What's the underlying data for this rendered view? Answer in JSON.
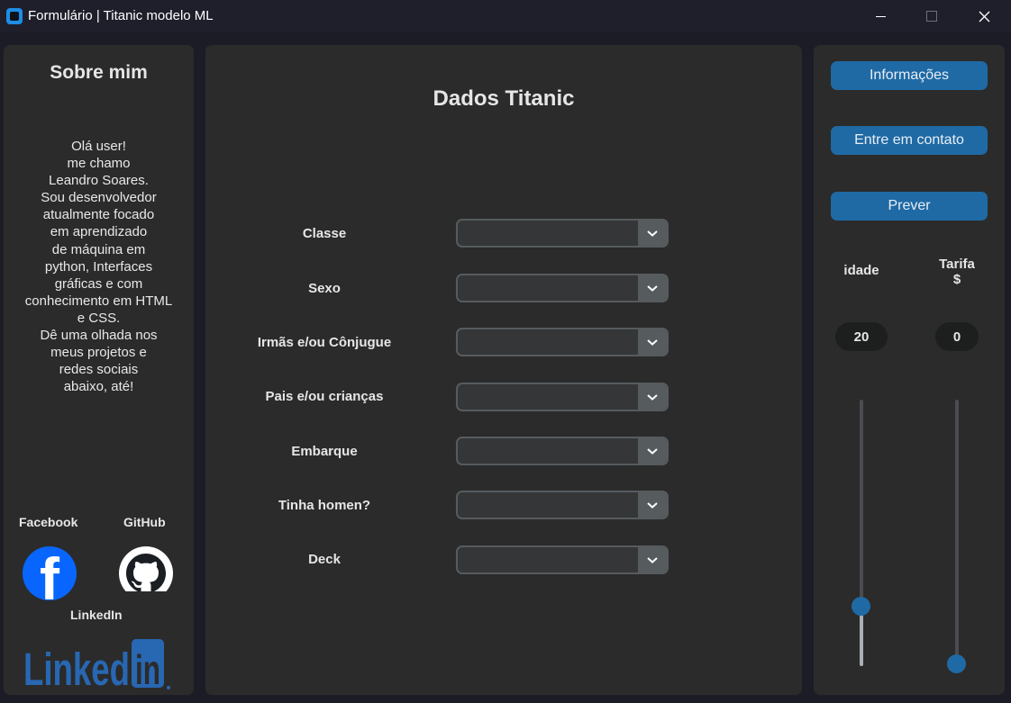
{
  "window": {
    "title": "Formulário | Titanic modelo ML"
  },
  "about": {
    "title": "Sobre mim",
    "text": "Olá user!\nme chamo\nLeandro Soares.\nSou desenvolvedor\natualmente focado\nem aprendizado\nde máquina em\npython, Interfaces\ngráficas e com\nconhecimento em HTML\ne CSS.\nDê uma olhada nos\nmeus projetos e\nredes sociais\nabaixo, até!"
  },
  "social": {
    "facebook_label": "Facebook",
    "github_label": "GitHub",
    "linkedin_label": "LinkedIn",
    "linkedin_logo_text": "Linked",
    "linkedin_logo_in": "in",
    "facebook_glyph": "f"
  },
  "form": {
    "title": "Dados Titanic",
    "fields": [
      {
        "label": "Classe",
        "value": ""
      },
      {
        "label": "Sexo",
        "value": ""
      },
      {
        "label": "Irmãs e/ou Cônjugue",
        "value": ""
      },
      {
        "label": "Pais e/ou crianças",
        "value": ""
      },
      {
        "label": "Embarque",
        "value": ""
      },
      {
        "label": "Tinha homen?",
        "value": ""
      },
      {
        "label": "Deck",
        "value": ""
      }
    ]
  },
  "actions": {
    "info_label": "Informações",
    "contact_label": "Entre em contato",
    "predict_label": "Prever"
  },
  "params": {
    "age": {
      "label": "idade",
      "value": "20",
      "level": 0.22
    },
    "fare": {
      "label": "Tarifa\n$",
      "value": "0",
      "level": 0.0
    }
  },
  "colors": {
    "accent": "#1f6aa5",
    "frame": "#2b2b2b",
    "background": "#1c1c26",
    "facebook": "#0866ff",
    "linkedin": "#2867b2"
  }
}
